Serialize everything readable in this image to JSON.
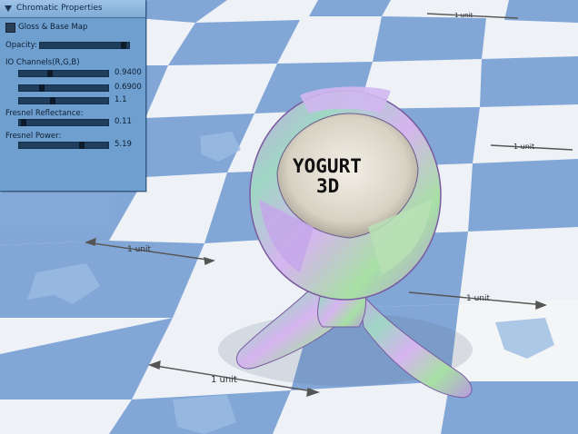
{
  "panel": {
    "title": "Chromatic Properties",
    "gloss_label": "Gloss & Base Map",
    "opacity_label": "Opacity:",
    "opacity_level": 0.97,
    "io_label": "IO Channels(R,G,B)",
    "io_channels": [
      {
        "value_text": "0.9400",
        "level": 0.34
      },
      {
        "value_text": "0.6900",
        "level": 0.24
      },
      {
        "value_text": "1.1",
        "level": 0.37
      }
    ],
    "fresnel_reflectance_label": "Fresnel Reflectance:",
    "fresnel_reflectance": {
      "value_text": "0.11",
      "level": 0.02
    },
    "fresnel_power_label": "Fresnel Power:",
    "fresnel_power": {
      "value_text": "5.19",
      "level": 0.72
    }
  },
  "scene": {
    "logo_line1": "YOGURT",
    "logo_line2": "3D",
    "unit_label": "1 unit",
    "colors": {
      "tile_blue": "#7da3d6",
      "tile_white": "#f4f6f8",
      "panel_blue": "#6f9fcf"
    }
  }
}
